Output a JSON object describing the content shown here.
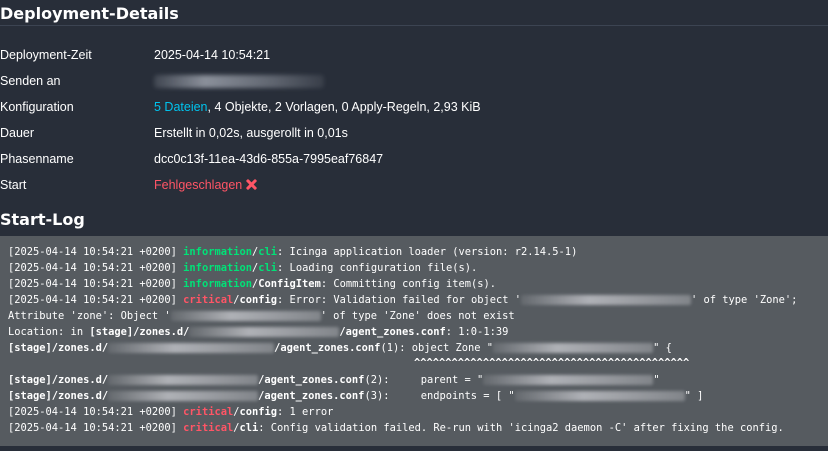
{
  "details": {
    "heading": "Deployment-Details",
    "rows": [
      {
        "label": "Deployment-Zeit",
        "value": "2025-04-14 10:54:21"
      },
      {
        "label": "Senden an",
        "value": ""
      },
      {
        "label": "Konfiguration",
        "link": "5 Dateien",
        "value": ", 4 Objekte, 2 Vorlagen, 0 Apply-Regeln, 2,93 KiB"
      },
      {
        "label": "Dauer",
        "value": "Erstellt in 0,02s, ausgerollt in 0,01s"
      },
      {
        "label": "Phasenname",
        "value": "dcc0c13f-11ea-43d6-855a-7995eaf76847"
      },
      {
        "label": "Start",
        "value": "Fehlgeschlagen"
      }
    ]
  },
  "log": {
    "heading": "Start-Log",
    "ts": "[2025-04-14 10:54:21 +0200]",
    "lines": {
      "l1": {
        "sev": "information",
        "fac": "cli",
        "msg": ": Icinga application loader (version: r2.14.5-1)"
      },
      "l2": {
        "sev": "information",
        "fac": "cli",
        "msg": ": Loading configuration file(s)."
      },
      "l3": {
        "sev": "information",
        "fac": "ConfigItem",
        "msg": ": Committing config item(s)."
      },
      "l4": {
        "sev": "critical",
        "fac": "config",
        "msg_a": ": Error: Validation failed for object '",
        "msg_b": "' of type 'Zone';"
      },
      "l5": {
        "a": "Attribute 'zone': Object '",
        "b": "' of type 'Zone' does not exist"
      },
      "l6": {
        "a": "Location: in ",
        "path_a": "[stage]/zones.d/",
        "path_b": "/agent_zones.conf",
        "b": ": 1:0-1:39"
      },
      "l7": {
        "path_a": "[stage]/zones.d/",
        "path_b": "/agent_zones.conf",
        "b": "(1): object Zone \"",
        "c": "\" {"
      },
      "l8": {
        "carets": "^^^^^^^^^^^^^^^^^^^^^^^^^^^^^^^^^^^^^^^^^^^^"
      },
      "l9": {
        "path_a": "[stage]/zones.d/",
        "path_b": "/agent_zones.conf",
        "b": "(2):     parent = \"",
        "c": "\""
      },
      "l10": {
        "path_a": "[stage]/zones.d/",
        "path_b": "/agent_zones.conf",
        "b": "(3):     endpoints = [ \"",
        "c": "\" ]"
      },
      "l11": {
        "sev": "critical",
        "fac": "config",
        "msg": ": 1 error"
      },
      "l12": {
        "sev": "critical",
        "fac": "cli",
        "msg": ": Config validation failed. Re-run with 'icinga2 daemon -C' after fixing the config."
      }
    }
  }
}
